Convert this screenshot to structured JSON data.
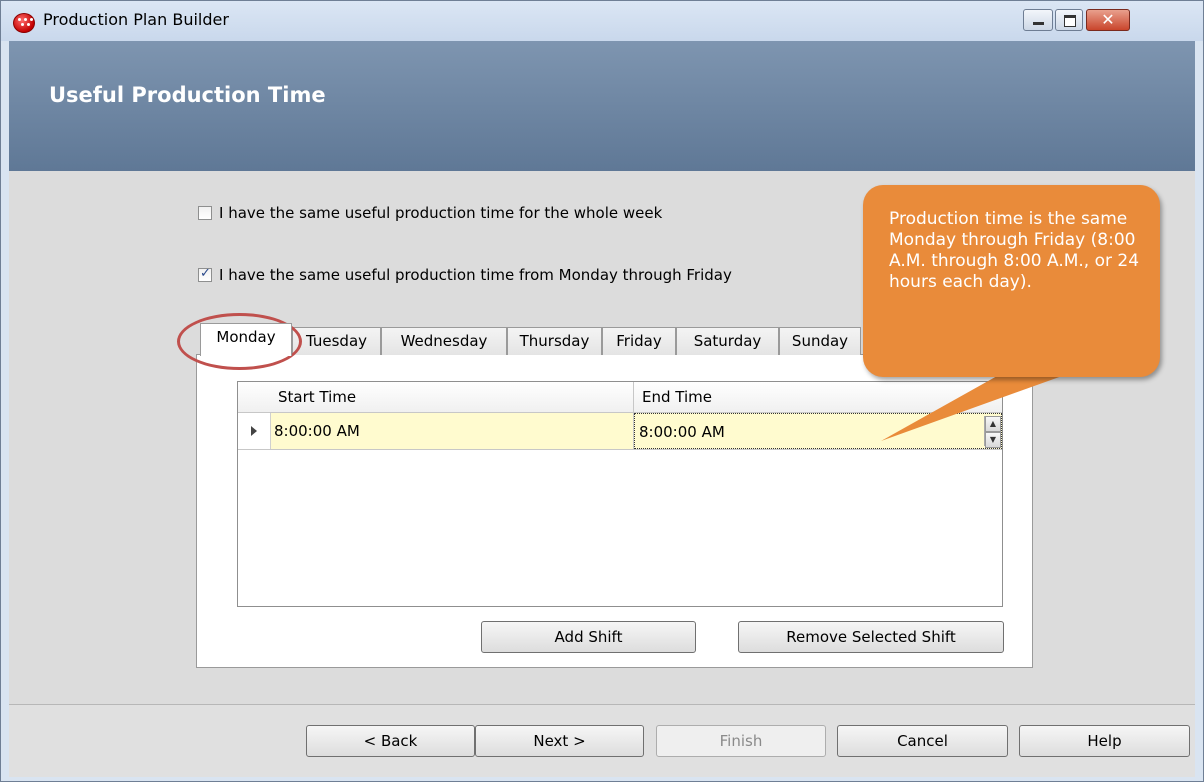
{
  "window": {
    "title": "Production Plan Builder",
    "close_glyph": "✕"
  },
  "header": {
    "title": "Useful Production Time"
  },
  "options": {
    "whole_week": {
      "label": "I have the same useful production time for the whole week",
      "checked": false
    },
    "mon_fri": {
      "label": "I have the same useful production time from Monday through Friday",
      "checked": true
    }
  },
  "tabs": [
    "Monday",
    "Tuesday",
    "Wednesday",
    "Thursday",
    "Friday",
    "Saturday",
    "Sunday"
  ],
  "active_tab": "Monday",
  "grid": {
    "columns": [
      "Start Time",
      "End Time"
    ],
    "rows": [
      {
        "start": "8:00:00 AM",
        "end": "8:00:00 AM"
      }
    ]
  },
  "panel_buttons": {
    "add": "Add Shift",
    "remove": "Remove Selected Shift"
  },
  "footer_buttons": {
    "back": "< Back",
    "next": "Next >",
    "finish": "Finish",
    "cancel": "Cancel",
    "help": "Help"
  },
  "callout": {
    "text": "Production time is the same Monday through Friday (8:00 A.M. through 8:00 A.M., or 24 hours each day)."
  },
  "colors": {
    "header": "#6a829f",
    "callout": "#e98b3a",
    "row_highlight": "#fffbcf",
    "annotation": "#c0504d"
  }
}
